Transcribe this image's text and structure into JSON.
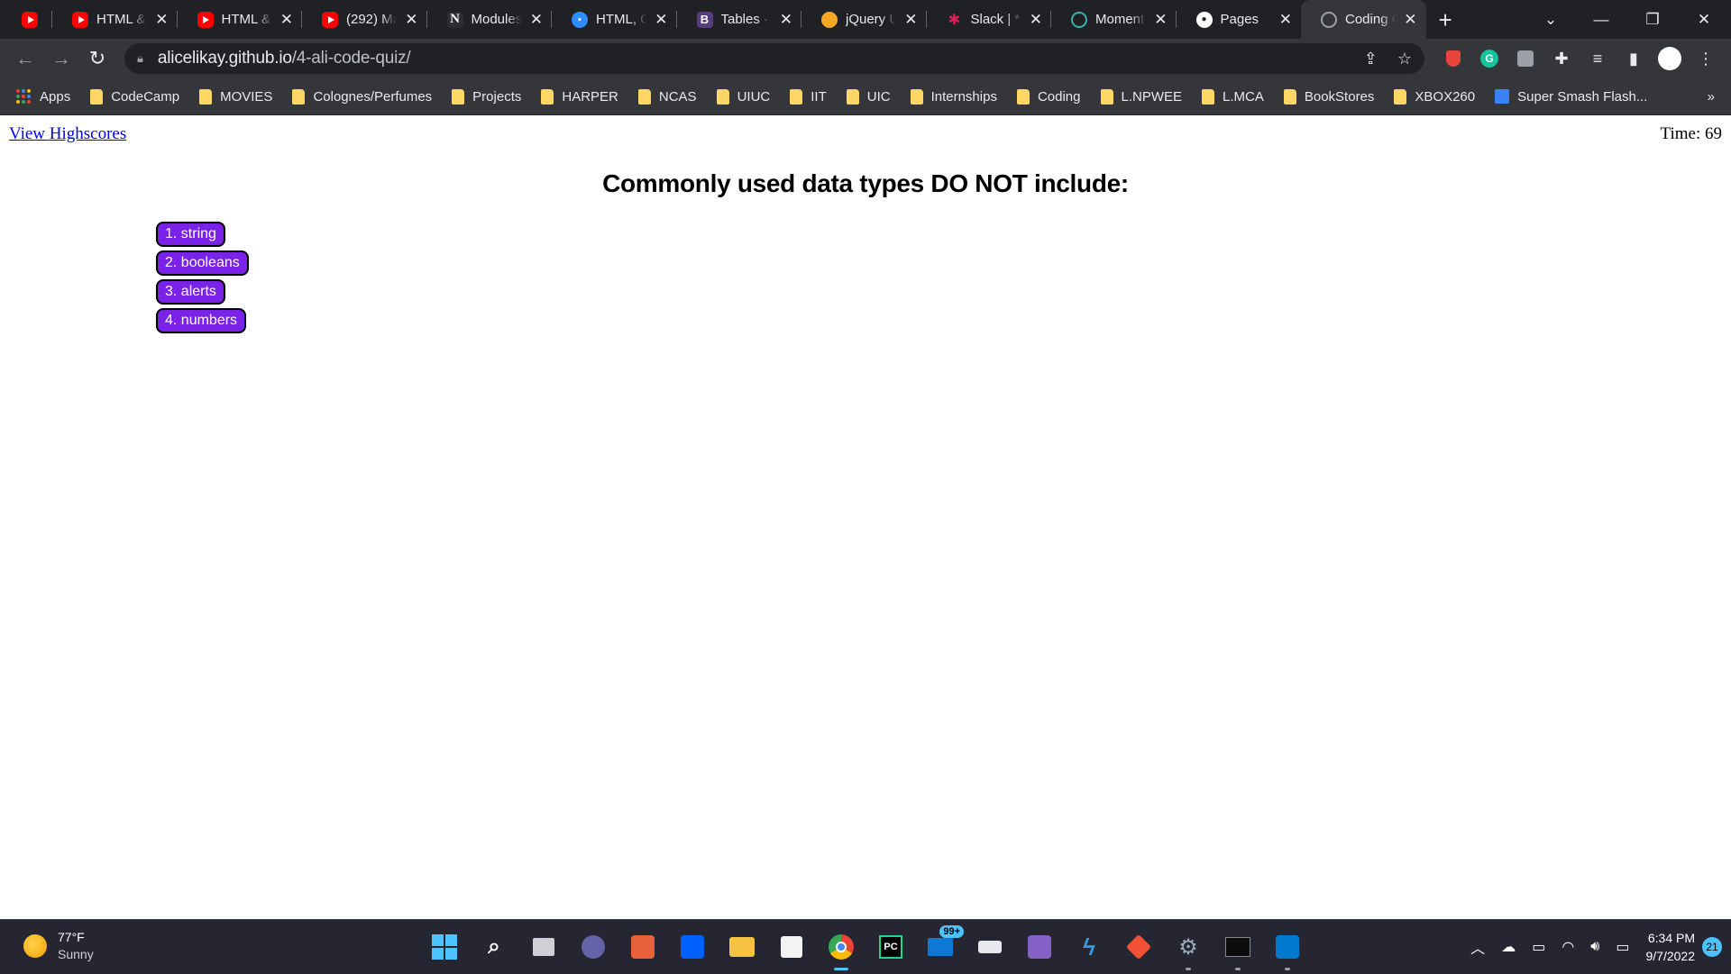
{
  "browser": {
    "tabs": [
      {
        "label": "",
        "favicon": "youtube-icon"
      },
      {
        "label": "HTML &",
        "favicon": "youtube-icon"
      },
      {
        "label": "HTML &",
        "favicon": "youtube-icon"
      },
      {
        "label": "(292) Ma",
        "favicon": "youtube-icon"
      },
      {
        "label": "Modules",
        "favicon": "notion-icon"
      },
      {
        "label": "HTML, C",
        "favicon": "zoom-icon"
      },
      {
        "label": "Tables · E",
        "favicon": "bootstrap-icon"
      },
      {
        "label": "jQuery U",
        "favicon": "jquery-icon"
      },
      {
        "label": "Slack | * I",
        "favicon": "slack-icon"
      },
      {
        "label": "Moment",
        "favicon": "moment-icon"
      },
      {
        "label": "Pages",
        "favicon": "github-icon"
      },
      {
        "label": "Coding C",
        "favicon": "globe-icon",
        "active": true
      }
    ],
    "url_host": "alicelikay.github.io",
    "url_path": "/4-ali-code-quiz/",
    "bookmarks": [
      "Apps",
      "CodeCamp",
      "MOVIES",
      "Colognes/Perfumes",
      "Projects",
      "HARPER",
      "NCAS",
      "UIUC",
      "IIT",
      "UIC",
      "Internships",
      "Coding",
      "L.NPWEE",
      "L.MCA",
      "BookStores",
      "XBOX260",
      "Super Smash Flash..."
    ],
    "bookmarks_more": "»"
  },
  "page": {
    "highscores_link": "View Highscores",
    "timer": "Time: 69",
    "question": "Commonly used data types DO NOT include:",
    "answers": [
      "1. string",
      "2. booleans",
      "3. alerts",
      "4. numbers"
    ],
    "answer_color": "#7b22e8"
  },
  "taskbar": {
    "weather_temp": "77°F",
    "weather_condition": "Sunny",
    "mail_badge": "99+",
    "time": "6:34 PM",
    "date": "9/7/2022",
    "notifications": "21"
  },
  "colors": {
    "chrome_dark": "#202124",
    "chrome_toolbar": "#35363a",
    "link": "#0000ee",
    "accent": "#4cc2ff"
  }
}
